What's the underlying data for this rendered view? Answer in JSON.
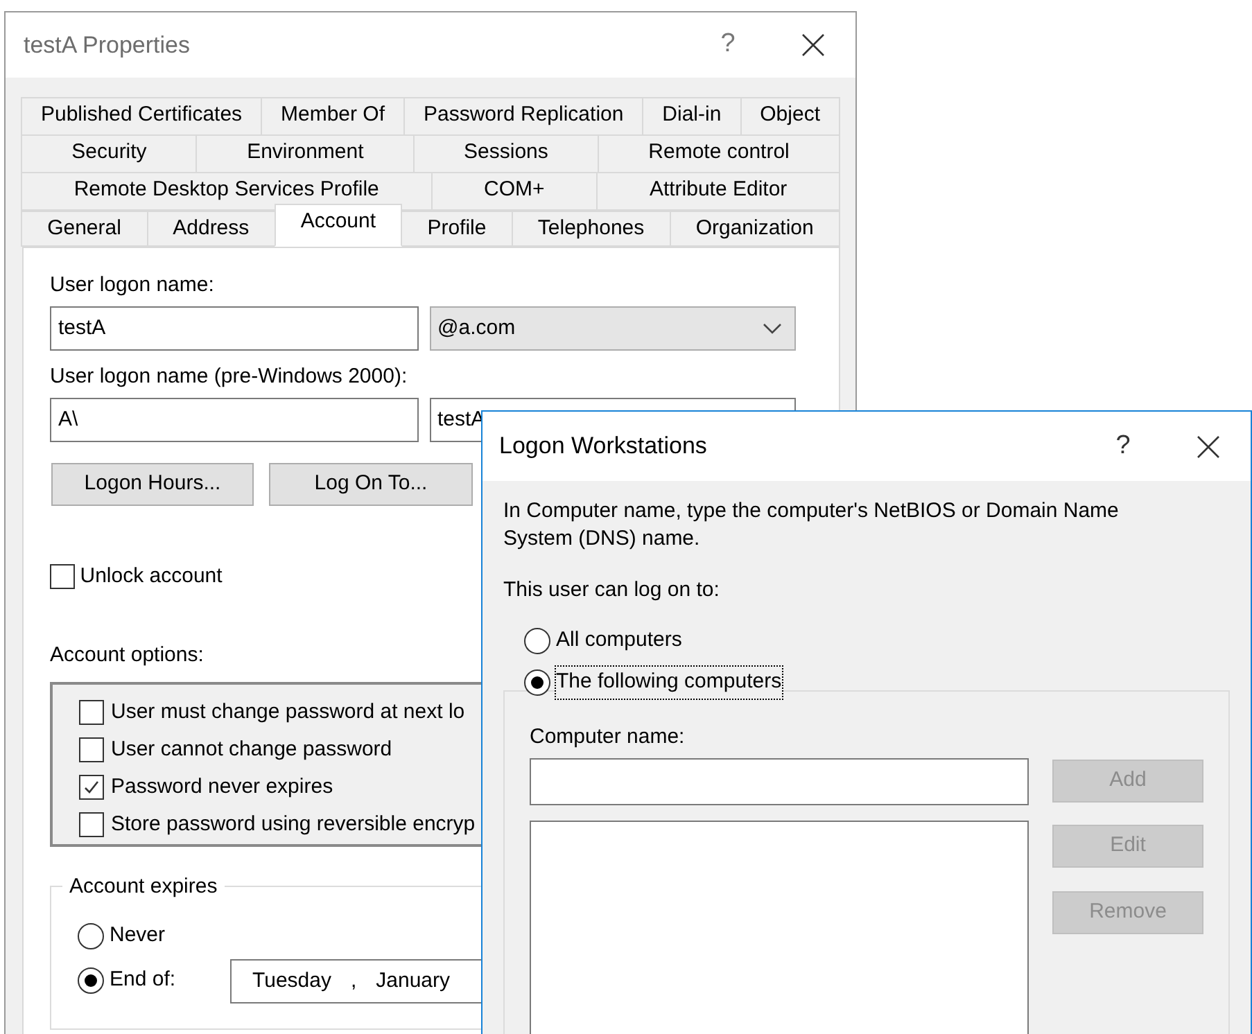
{
  "properties_window": {
    "title": "testA Properties",
    "help_button": "?",
    "tab_rows": [
      [
        {
          "label": "Published Certificates",
          "selected": false
        },
        {
          "label": "Member Of",
          "selected": false
        },
        {
          "label": "Password Replication",
          "selected": false
        },
        {
          "label": "Dial-in",
          "selected": false
        },
        {
          "label": "Object",
          "selected": false
        }
      ],
      [
        {
          "label": "Security",
          "selected": false
        },
        {
          "label": "Environment",
          "selected": false
        },
        {
          "label": "Sessions",
          "selected": false
        },
        {
          "label": "Remote control",
          "selected": false
        }
      ],
      [
        {
          "label": "Remote Desktop Services Profile",
          "selected": false
        },
        {
          "label": "COM+",
          "selected": false
        },
        {
          "label": "Attribute Editor",
          "selected": false
        }
      ],
      [
        {
          "label": "General",
          "selected": false
        },
        {
          "label": "Address",
          "selected": false
        },
        {
          "label": "Account",
          "selected": true
        },
        {
          "label": "Profile",
          "selected": false
        },
        {
          "label": "Telephones",
          "selected": false
        },
        {
          "label": "Organization",
          "selected": false
        }
      ]
    ],
    "account": {
      "logon_name_label": "User logon name:",
      "logon_name": "testA",
      "domain": "@a.com",
      "pre2000_label": "User logon name (pre-Windows 2000):",
      "pre2000_domain": "A\\",
      "pre2000_name": "testA",
      "buttons": [
        "Logon Hours...",
        "Log On To..."
      ],
      "unlock": {
        "label": "Unlock account",
        "checked": false
      },
      "options_label": "Account options:",
      "options": [
        {
          "label": "User must change password at next lo",
          "checked": false
        },
        {
          "label": "User cannot change password",
          "checked": false
        },
        {
          "label": "Password never expires",
          "checked": true
        },
        {
          "label": "Store password using reversible encryp",
          "checked": false
        }
      ],
      "expires": {
        "legend": "Account expires",
        "choices": [
          {
            "label": "Never",
            "selected": false
          },
          {
            "label": "End of:",
            "selected": true
          }
        ],
        "date": {
          "weekday": "Tuesday",
          "separator": ",",
          "month": "January"
        }
      }
    }
  },
  "logon_workstations": {
    "title": "Logon Workstations",
    "help_button": "?",
    "intro": "In Computer name, type the computer's NetBIOS or Domain Name System (DNS) name.",
    "prompt": "This user can log on to:",
    "choices": [
      {
        "label": "All computers",
        "selected": false,
        "focused": false
      },
      {
        "label": "The following computers",
        "selected": true,
        "focused": true
      }
    ],
    "computer_name_label": "Computer name:",
    "buttons": [
      {
        "label": "Add",
        "disabled": true
      },
      {
        "label": "Edit",
        "disabled": true
      },
      {
        "label": "Remove",
        "disabled": true
      }
    ]
  }
}
